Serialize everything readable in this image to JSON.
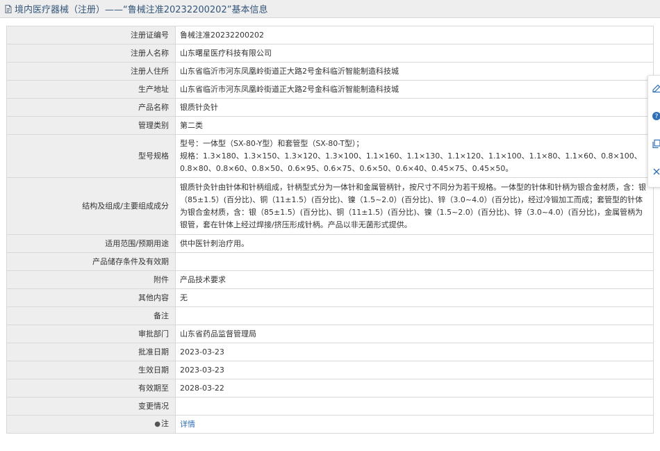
{
  "header": {
    "title": "境内医疗器械（注册）——“鲁械注准20232200202”基本信息"
  },
  "rows": [
    {
      "label": "注册证编号",
      "value": "鲁械注准20232200202"
    },
    {
      "label": "注册人名称",
      "value": "山东曙星医疗科技有限公司"
    },
    {
      "label": "注册人住所",
      "value": "山东省临沂市河东凤凰岭街道正大路2号金科临沂智能制造科技城"
    },
    {
      "label": "生产地址",
      "value": "山东省临沂市河东凤凰岭街道正大路2号金科临沂智能制造科技城"
    },
    {
      "label": "产品名称",
      "value": "银质针灸针"
    },
    {
      "label": "管理类别",
      "value": "第二类"
    },
    {
      "label": "型号规格",
      "value_line1": "型号：一体型（SX-80-Y型）和套管型（SX-80-T型）；",
      "value_line2": "规格：1.3×180、1.3×150、1.3×120、1.3×100、1.1×160、1.1×130、1.1×120、1.1×100、1.1×80、1.1×60、0.8×100、0.8×80、0.8×60、0.8×50、0.6×95、0.6×75、0.6×50、0.6×40、0.45×75、0.45×50。"
    },
    {
      "label": "结构及组成/主要组成成分",
      "value": "银质针灸针由针体和针柄组成，针柄型式分为一体针和金属管柄针，按尺寸不同分为若干规格。一体型的针体和针柄为银合金材质，含：银（85±1.5）(百分比)、铜（11±1.5）(百分比)、镍（1.5~2.0）(百分比)、锌（3.0~4.0）(百分比)，经过冷锻加工而成；套管型的针体为银合金材质，含：银（85±1.5）(百分比)、铜（11±1.5）(百分比)、镍（1.5~2.0）(百分比)、锌（3.0~4.0）(百分比)，金属管柄为银管，套在针体上经过焊接/挤压形成针柄。产品以非无菌形式提供。"
    },
    {
      "label": "适用范围/预期用途",
      "value": "供中医针刺治疗用。"
    },
    {
      "label": "产品储存条件及有效期",
      "value": ""
    },
    {
      "label": "附件",
      "value": "产品技术要求"
    },
    {
      "label": "其他内容",
      "value": "无"
    },
    {
      "label": "备注",
      "value": ""
    },
    {
      "label": "审批部门",
      "value": "山东省药品监督管理局"
    },
    {
      "label": "批准日期",
      "value": "2023-03-23"
    },
    {
      "label": "生效日期",
      "value": "2023-03-23"
    },
    {
      "label": "有效期至",
      "value": "2028-03-22"
    },
    {
      "label": "变更情况",
      "value": ""
    },
    {
      "label": "注",
      "value": "详情"
    }
  ],
  "icons": {
    "header": "document-icon",
    "note": "pin-icon",
    "side": [
      "edit-icon",
      "help-icon",
      "copy-icon",
      "close-icon"
    ]
  },
  "colors": {
    "header_text": "#33557a",
    "label_bg": "#eeeeee",
    "link": "#2f6fb7",
    "border": "#d8d8d8"
  }
}
